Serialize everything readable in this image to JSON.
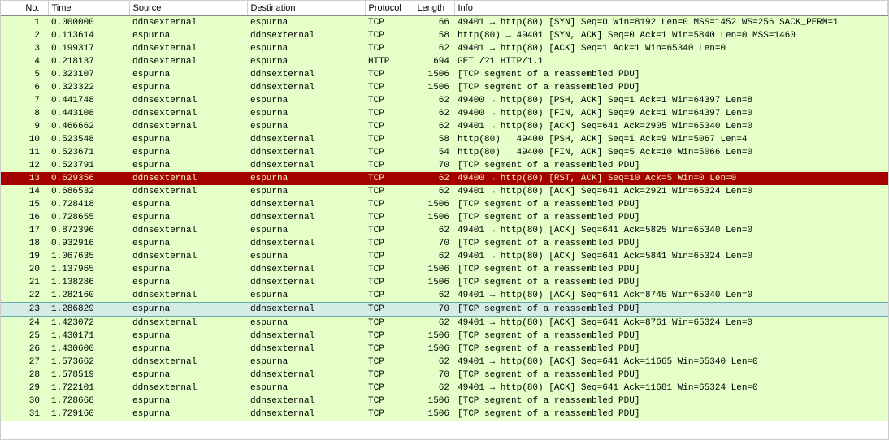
{
  "columns": {
    "no": "No.",
    "time": "Time",
    "source": "Source",
    "destination": "Destination",
    "protocol": "Protocol",
    "length": "Length",
    "info": "Info"
  },
  "rows": [
    {
      "no": "1",
      "time": "0.000000",
      "src": "ddnsexternal",
      "dst": "espurna",
      "proto": "TCP",
      "len": "66",
      "info": "49401 → http(80) [SYN] Seq=0 Win=8192 Len=0 MSS=1452 WS=256 SACK_PERM=1",
      "style": "green"
    },
    {
      "no": "2",
      "time": "0.113614",
      "src": "espurna",
      "dst": "ddnsexternal",
      "proto": "TCP",
      "len": "58",
      "info": "http(80) → 49401 [SYN, ACK] Seq=0 Ack=1 Win=5840 Len=0 MSS=1460",
      "style": "green"
    },
    {
      "no": "3",
      "time": "0.199317",
      "src": "ddnsexternal",
      "dst": "espurna",
      "proto": "TCP",
      "len": "62",
      "info": "49401 → http(80) [ACK] Seq=1 Ack=1 Win=65340 Len=0",
      "style": "green"
    },
    {
      "no": "4",
      "time": "0.218137",
      "src": "ddnsexternal",
      "dst": "espurna",
      "proto": "HTTP",
      "len": "694",
      "info": "GET /?1 HTTP/1.1",
      "style": "green"
    },
    {
      "no": "5",
      "time": "0.323107",
      "src": "espurna",
      "dst": "ddnsexternal",
      "proto": "TCP",
      "len": "1506",
      "info": "[TCP segment of a reassembled PDU]",
      "style": "green"
    },
    {
      "no": "6",
      "time": "0.323322",
      "src": "espurna",
      "dst": "ddnsexternal",
      "proto": "TCP",
      "len": "1506",
      "info": "[TCP segment of a reassembled PDU]",
      "style": "green"
    },
    {
      "no": "7",
      "time": "0.441748",
      "src": "ddnsexternal",
      "dst": "espurna",
      "proto": "TCP",
      "len": "62",
      "info": "49400 → http(80) [PSH, ACK] Seq=1 Ack=1 Win=64397 Len=8",
      "style": "green"
    },
    {
      "no": "8",
      "time": "0.443108",
      "src": "ddnsexternal",
      "dst": "espurna",
      "proto": "TCP",
      "len": "62",
      "info": "49400 → http(80) [FIN, ACK] Seq=9 Ack=1 Win=64397 Len=0",
      "style": "green"
    },
    {
      "no": "9",
      "time": "0.466662",
      "src": "ddnsexternal",
      "dst": "espurna",
      "proto": "TCP",
      "len": "62",
      "info": "49401 → http(80) [ACK] Seq=641 Ack=2905 Win=65340 Len=0",
      "style": "green"
    },
    {
      "no": "10",
      "time": "0.523548",
      "src": "espurna",
      "dst": "ddnsexternal",
      "proto": "TCP",
      "len": "58",
      "info": "http(80) → 49400 [PSH, ACK] Seq=1 Ack=9 Win=5067 Len=4",
      "style": "green"
    },
    {
      "no": "11",
      "time": "0.523671",
      "src": "espurna",
      "dst": "ddnsexternal",
      "proto": "TCP",
      "len": "54",
      "info": "http(80) → 49400 [FIN, ACK] Seq=5 Ack=10 Win=5066 Len=0",
      "style": "green"
    },
    {
      "no": "12",
      "time": "0.523791",
      "src": "espurna",
      "dst": "ddnsexternal",
      "proto": "TCP",
      "len": "70",
      "info": "[TCP segment of a reassembled PDU]",
      "style": "green"
    },
    {
      "no": "13",
      "time": "0.629356",
      "src": "ddnsexternal",
      "dst": "espurna",
      "proto": "TCP",
      "len": "62",
      "info": "49400 → http(80) [RST, ACK] Seq=10 Ack=5 Win=0 Len=0",
      "style": "red"
    },
    {
      "no": "14",
      "time": "0.686532",
      "src": "ddnsexternal",
      "dst": "espurna",
      "proto": "TCP",
      "len": "62",
      "info": "49401 → http(80) [ACK] Seq=641 Ack=2921 Win=65324 Len=0",
      "style": "green"
    },
    {
      "no": "15",
      "time": "0.728418",
      "src": "espurna",
      "dst": "ddnsexternal",
      "proto": "TCP",
      "len": "1506",
      "info": "[TCP segment of a reassembled PDU]",
      "style": "green"
    },
    {
      "no": "16",
      "time": "0.728655",
      "src": "espurna",
      "dst": "ddnsexternal",
      "proto": "TCP",
      "len": "1506",
      "info": "[TCP segment of a reassembled PDU]",
      "style": "green"
    },
    {
      "no": "17",
      "time": "0.872396",
      "src": "ddnsexternal",
      "dst": "espurna",
      "proto": "TCP",
      "len": "62",
      "info": "49401 → http(80) [ACK] Seq=641 Ack=5825 Win=65340 Len=0",
      "style": "green"
    },
    {
      "no": "18",
      "time": "0.932916",
      "src": "espurna",
      "dst": "ddnsexternal",
      "proto": "TCP",
      "len": "70",
      "info": "[TCP segment of a reassembled PDU]",
      "style": "green"
    },
    {
      "no": "19",
      "time": "1.067635",
      "src": "ddnsexternal",
      "dst": "espurna",
      "proto": "TCP",
      "len": "62",
      "info": "49401 → http(80) [ACK] Seq=641 Ack=5841 Win=65324 Len=0",
      "style": "green"
    },
    {
      "no": "20",
      "time": "1.137965",
      "src": "espurna",
      "dst": "ddnsexternal",
      "proto": "TCP",
      "len": "1506",
      "info": "[TCP segment of a reassembled PDU]",
      "style": "green"
    },
    {
      "no": "21",
      "time": "1.138286",
      "src": "espurna",
      "dst": "ddnsexternal",
      "proto": "TCP",
      "len": "1506",
      "info": "[TCP segment of a reassembled PDU]",
      "style": "green"
    },
    {
      "no": "22",
      "time": "1.282160",
      "src": "ddnsexternal",
      "dst": "espurna",
      "proto": "TCP",
      "len": "62",
      "info": "49401 → http(80) [ACK] Seq=641 Ack=8745 Win=65340 Len=0",
      "style": "green"
    },
    {
      "no": "23",
      "time": "1.286829",
      "src": "espurna",
      "dst": "ddnsexternal",
      "proto": "TCP",
      "len": "70",
      "info": "[TCP segment of a reassembled PDU]",
      "style": "selected"
    },
    {
      "no": "24",
      "time": "1.423072",
      "src": "ddnsexternal",
      "dst": "espurna",
      "proto": "TCP",
      "len": "62",
      "info": "49401 → http(80) [ACK] Seq=641 Ack=8761 Win=65324 Len=0",
      "style": "green"
    },
    {
      "no": "25",
      "time": "1.430171",
      "src": "espurna",
      "dst": "ddnsexternal",
      "proto": "TCP",
      "len": "1506",
      "info": "[TCP segment of a reassembled PDU]",
      "style": "green"
    },
    {
      "no": "26",
      "time": "1.430600",
      "src": "espurna",
      "dst": "ddnsexternal",
      "proto": "TCP",
      "len": "1506",
      "info": "[TCP segment of a reassembled PDU]",
      "style": "green"
    },
    {
      "no": "27",
      "time": "1.573662",
      "src": "ddnsexternal",
      "dst": "espurna",
      "proto": "TCP",
      "len": "62",
      "info": "49401 → http(80) [ACK] Seq=641 Ack=11665 Win=65340 Len=0",
      "style": "green"
    },
    {
      "no": "28",
      "time": "1.578519",
      "src": "espurna",
      "dst": "ddnsexternal",
      "proto": "TCP",
      "len": "70",
      "info": "[TCP segment of a reassembled PDU]",
      "style": "green"
    },
    {
      "no": "29",
      "time": "1.722101",
      "src": "ddnsexternal",
      "dst": "espurna",
      "proto": "TCP",
      "len": "62",
      "info": "49401 → http(80) [ACK] Seq=641 Ack=11681 Win=65324 Len=0",
      "style": "green"
    },
    {
      "no": "30",
      "time": "1.728668",
      "src": "espurna",
      "dst": "ddnsexternal",
      "proto": "TCP",
      "len": "1506",
      "info": "[TCP segment of a reassembled PDU]",
      "style": "green"
    },
    {
      "no": "31",
      "time": "1.729160",
      "src": "espurna",
      "dst": "ddnsexternal",
      "proto": "TCP",
      "len": "1506",
      "info": "[TCP segment of a reassembled PDU]",
      "style": "green"
    }
  ]
}
